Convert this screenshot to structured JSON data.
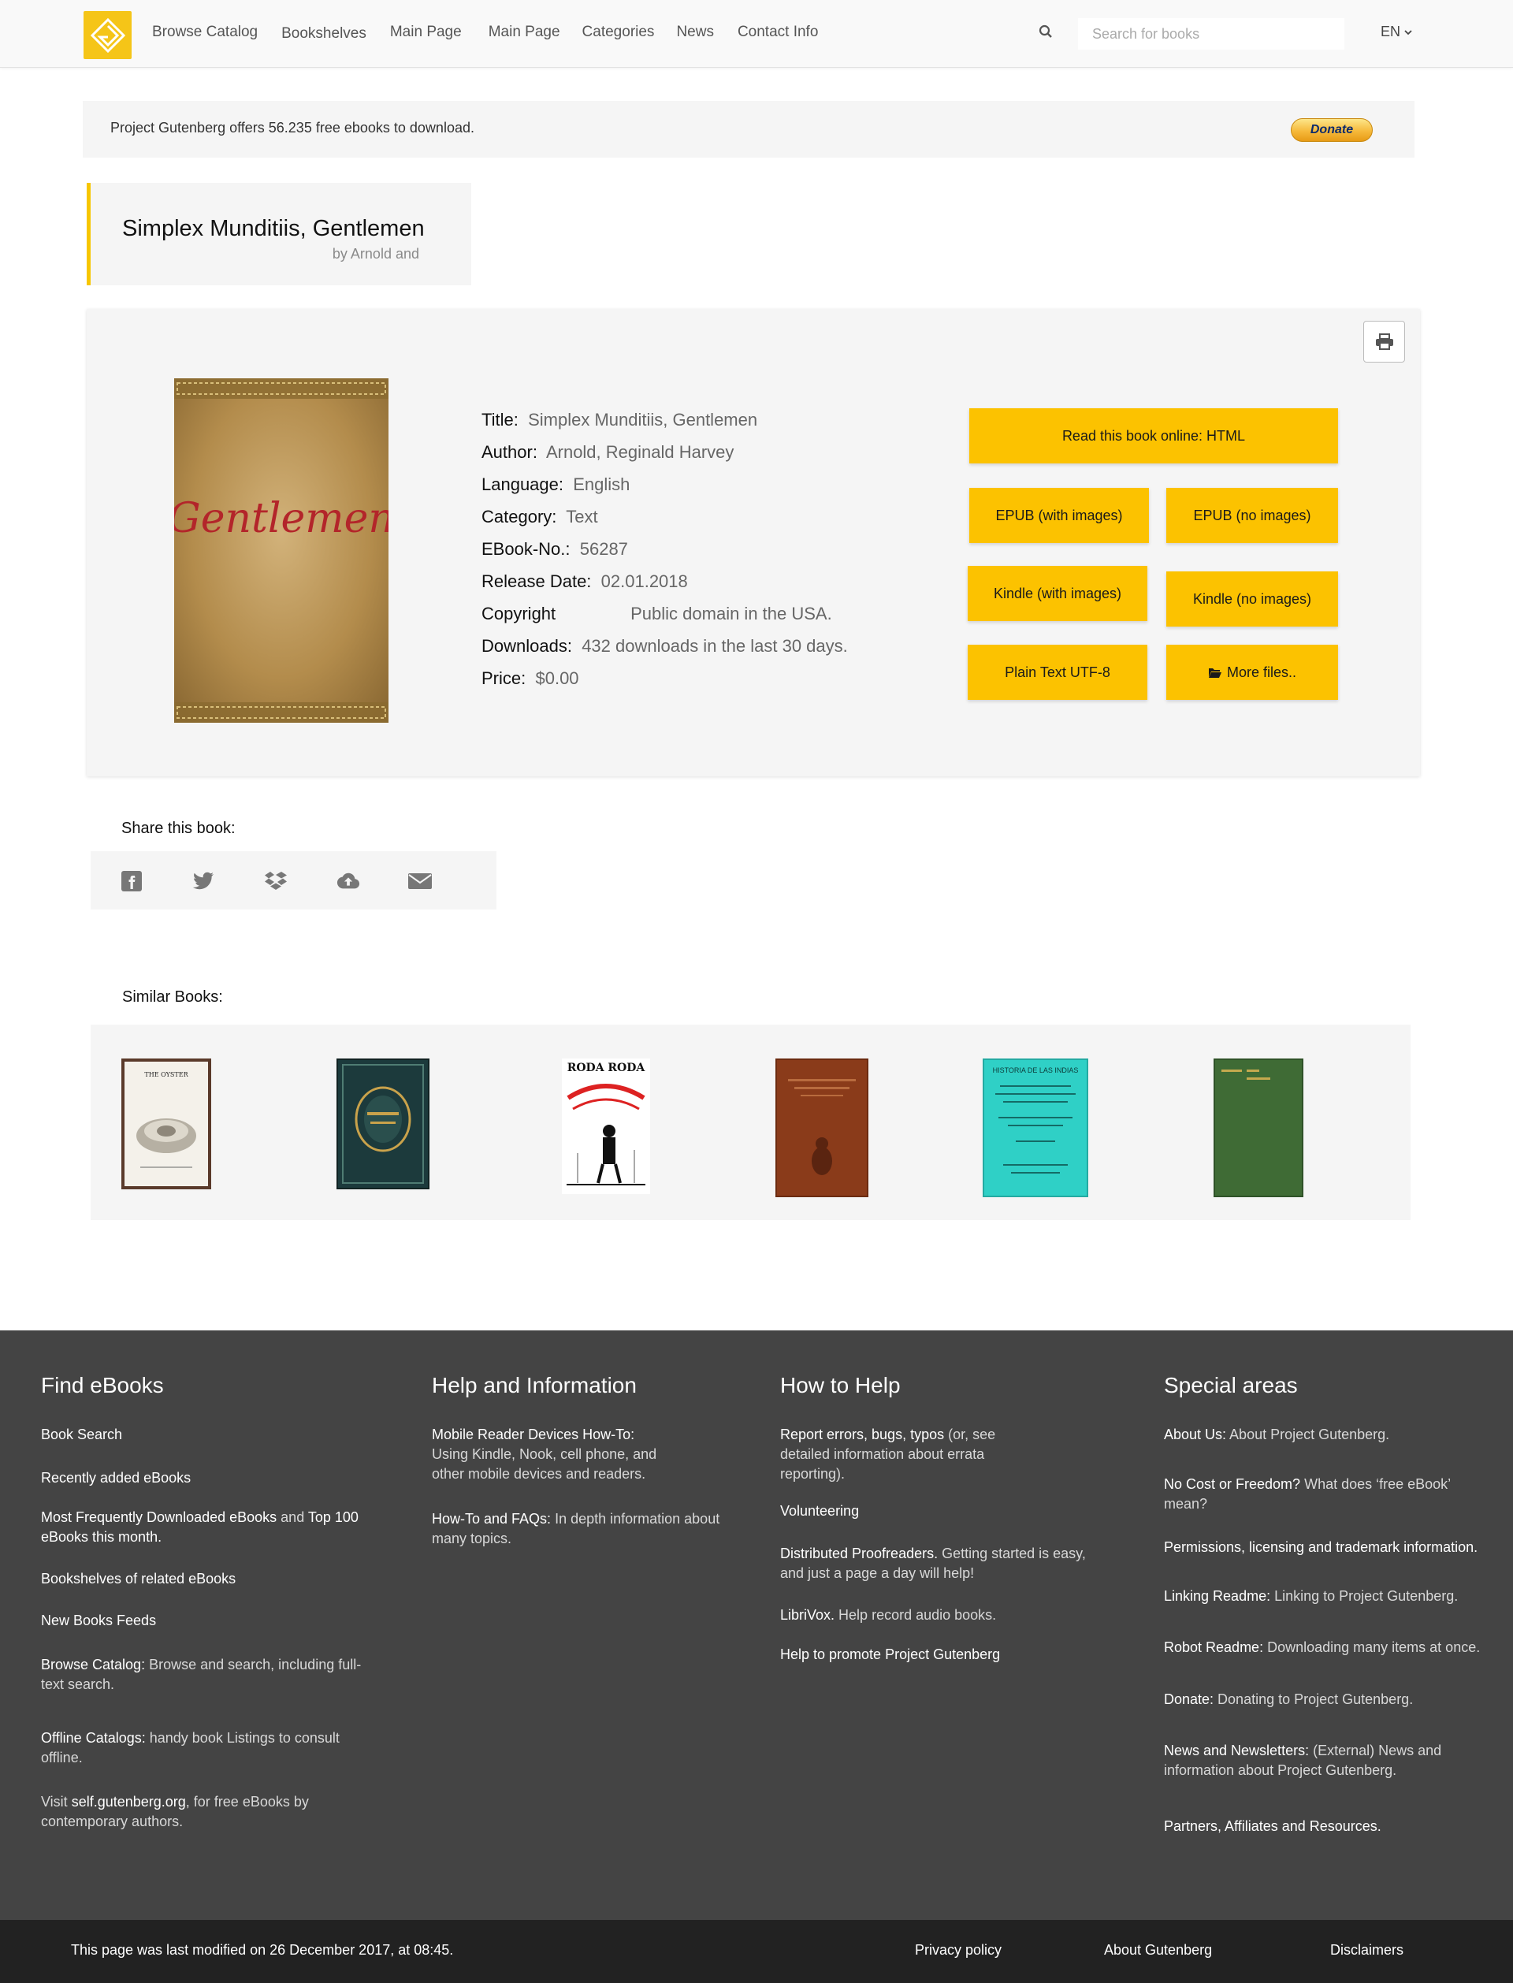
{
  "nav": {
    "items": [
      "Browse Catalog",
      "Bookshelves",
      "Main Page",
      "Main Page",
      "Categories",
      "News",
      "Contact Info"
    ],
    "search_placeholder": "Search for books",
    "language": "EN"
  },
  "banner": {
    "text": "Project Gutenberg offers 56.235 free ebooks to download.",
    "donate_label": "Donate"
  },
  "book": {
    "title": "Simplex Munditiis, Gentlemen",
    "byline": "by Arnold and",
    "cover_text": "Gentlemen",
    "details": [
      {
        "label": "Title:",
        "value": "Simplex Munditiis, Gentlemen"
      },
      {
        "label": "Author:",
        "value": "Arnold, Reginald Harvey"
      },
      {
        "label": "Language:",
        "value": "English"
      },
      {
        "label": "Category:",
        "value": "Text"
      },
      {
        "label": "EBook-No.:",
        "value": "56287"
      },
      {
        "label": "Release Date:",
        "value": "02.01.2018"
      },
      {
        "label": "Copyright",
        "value": "Public domain in the USA."
      },
      {
        "label": "Downloads:",
        "value": "432 downloads in the last 30 days."
      },
      {
        "label": "Price:",
        "value": "$0.00"
      }
    ]
  },
  "downloads": {
    "read_online": "Read this book online: HTML",
    "epub_images": "EPUB (with images)",
    "epub_no_images": "EPUB (no images)",
    "kindle_images": "Kindle (with images)",
    "kindle_no_images": "Kindle (no images)",
    "plain_text": "Plain Text UTF-8",
    "more_files": "More files.."
  },
  "share": {
    "heading": "Share this book:",
    "icons": [
      "facebook-icon",
      "twitter-icon",
      "dropbox-icon",
      "cloud-upload-icon",
      "envelope-icon"
    ]
  },
  "similar": {
    "heading": "Similar Books:",
    "covers": [
      {
        "text": "THE OYSTER",
        "bg": "#f4f1ea",
        "border": "#5a3a2a"
      },
      {
        "text": "",
        "bg": "#1c3a3c",
        "border": "#122"
      },
      {
        "text": "RODA RODA",
        "bg": "#ffffff",
        "border": "#ffffff"
      },
      {
        "text": "",
        "bg": "#8a3b1a",
        "border": "#6b2b10"
      },
      {
        "text": "HISTORIA DE LAS INDIAS",
        "bg": "#2fd0c6",
        "border": "#24aaa2"
      },
      {
        "text": "",
        "bg": "#3f6b35",
        "border": "#2f5228"
      }
    ]
  },
  "footer": {
    "find_ebooks": {
      "title": "Find eBooks",
      "book_search": "Book Search",
      "recently_added": "Recently added eBooks",
      "most_downloaded": "Most Frequently Downloaded eBooks",
      "and": " and ",
      "top100": "Top 100 eBooks this month.",
      "bookshelves": "Bookshelves of related eBooks",
      "feeds": "New Books Feeds",
      "browse_catalog": "Browse Catalog:",
      "browse_catalog_desc": " Browse and search, including full-text search.",
      "offline_catalogs": "Offline Catalogs:",
      "offline_catalogs_desc": " handy book Listings to consult offline.",
      "visit": "Visit ",
      "self_gutenberg": "self.gutenberg.org",
      "self_desc": ", for free eBooks by contemporary authors."
    },
    "help_info": {
      "title": "Help and Information",
      "mobile": "Mobile Reader Devices How-To:",
      "mobile_desc": "Using Kindle, Nook, cell phone, and other mobile devices and readers.",
      "howto": "How-To and FAQs:",
      "howto_desc": " In depth information about many topics."
    },
    "how_to_help": {
      "title": "How to Help",
      "report": "Report errors, bugs, typos",
      "report_desc": " (or, see detailed information about errata reporting).",
      "volunteering": "Volunteering",
      "dp": "Distributed Proofreaders.",
      "dp_desc": " Getting started is easy, and just a page a day will help!",
      "librivox": "LibriVox.",
      "librivox_desc": " Help record audio books.",
      "promote": "Help to promote Project Gutenberg"
    },
    "special": {
      "title": "Special areas",
      "about": "About Us:",
      "about_desc": " About Project Gutenberg.",
      "nocost": "No Cost or Freedom?",
      "nocost_desc": " What does ‘free eBook’ mean?",
      "permissions": "Permissions, licensing and trademark information.",
      "linking": "Linking Readme:",
      "linking_desc": " Linking to Project Gutenberg.",
      "robot": "Robot Readme:",
      "robot_desc": " Downloading many items at once.",
      "donate": "Donate:",
      "donate_desc": " Donating to Project Gutenberg.",
      "news": "News and Newsletters:",
      "news_desc": " (External) News and information about Project Gutenberg.",
      "partners": "Partners, Affiliates and Resources."
    },
    "bottom": {
      "modified": "This page was last modified on 26 December 2017, at 08:45.",
      "privacy": "Privacy policy",
      "about": "About Gutenberg",
      "disclaimers": "Disclaimers"
    }
  },
  "colors": {
    "accent_yellow": "#fcc200",
    "footer_bg": "#444444",
    "bottombar_bg": "#222222"
  }
}
